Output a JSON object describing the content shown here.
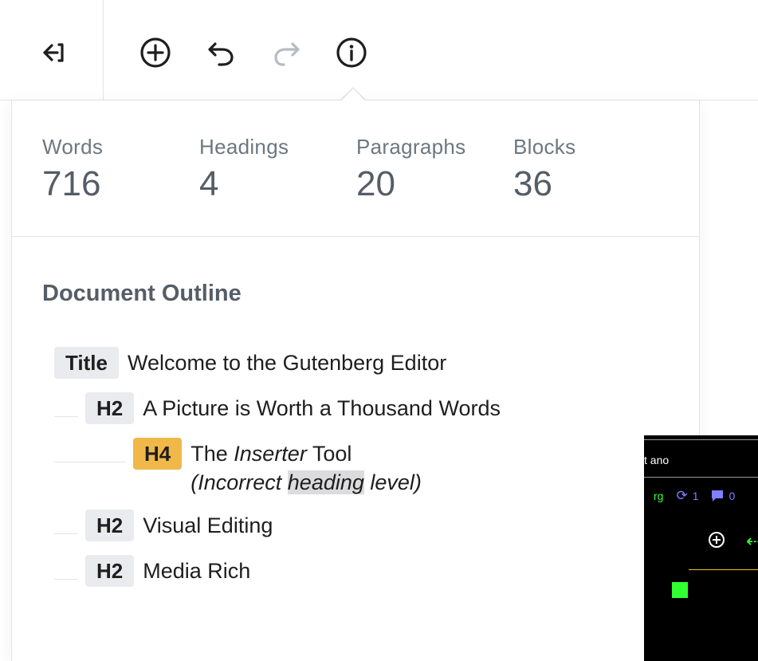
{
  "toolbar": {
    "buttons": [
      {
        "name": "close-sidebar-icon",
        "enabled": true
      },
      {
        "name": "add-block-icon",
        "enabled": true
      },
      {
        "name": "undo-icon",
        "enabled": true
      },
      {
        "name": "redo-icon",
        "enabled": false
      },
      {
        "name": "info-icon",
        "enabled": true
      }
    ],
    "colors": {
      "icon": "#1e1e1e",
      "disabled": "#b5bcc2"
    }
  },
  "stats": [
    {
      "label": "Words",
      "value": "716"
    },
    {
      "label": "Headings",
      "value": "4"
    },
    {
      "label": "Paragraphs",
      "value": "20"
    },
    {
      "label": "Blocks",
      "value": "36"
    }
  ],
  "outline": {
    "title": "Document Outline",
    "items": [
      {
        "level": "Title",
        "text": "Welcome to the Gutenberg Editor"
      },
      {
        "level": "H2",
        "text": "A Picture is Worth a Thousand Words"
      },
      {
        "level": "H4",
        "text_before": "The ",
        "text_italic": "Inserter",
        "text_after": " Tool",
        "note_before": "(Incorrect ",
        "note_highlight": "heading",
        "note_after": " level)"
      },
      {
        "level": "H2",
        "text": "Visual Editing"
      },
      {
        "level": "H2",
        "text": "Media Rich"
      }
    ],
    "colors": {
      "badge": "#e9ebee",
      "warning_badge": "#f0b849"
    }
  },
  "overlay": {
    "text": "t ano",
    "fragment": "rg",
    "sync_count": "1",
    "comment_count": "0"
  }
}
